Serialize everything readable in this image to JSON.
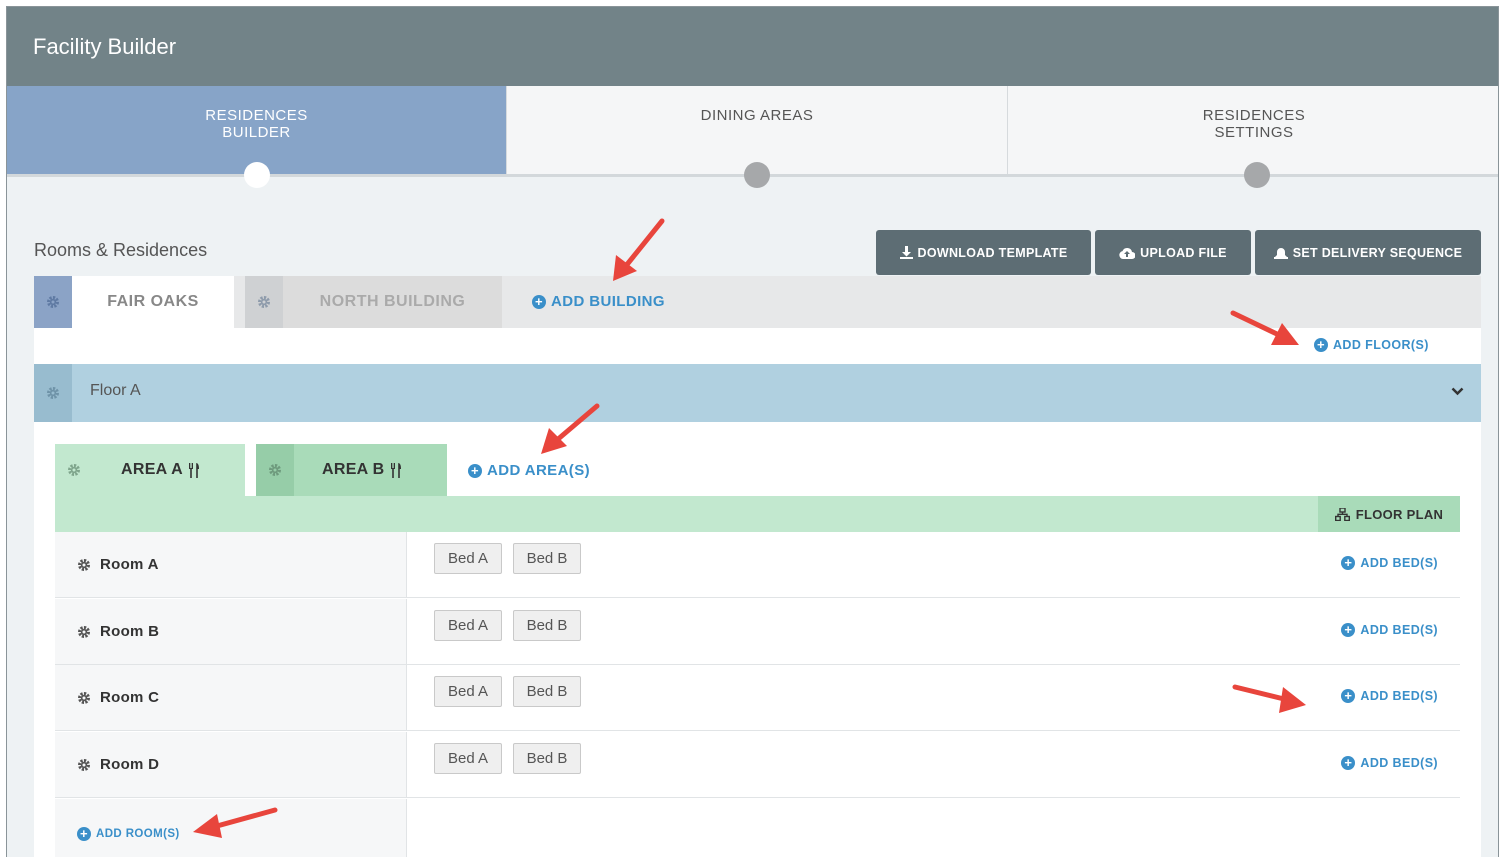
{
  "app": {
    "title": "Facility Builder"
  },
  "steps": [
    {
      "label_line1": "RESIDENCES",
      "label_line2": "BUILDER",
      "active": true
    },
    {
      "label_line1": "DINING AREAS",
      "label_line2": "",
      "active": false
    },
    {
      "label_line1": "RESIDENCES",
      "label_line2": "SETTINGS",
      "active": false
    }
  ],
  "section": {
    "title": "Rooms & Residences"
  },
  "toolbar": {
    "download_label": "DOWNLOAD TEMPLATE",
    "upload_label": "UPLOAD FILE",
    "delivery_label": "SET DELIVERY SEQUENCE"
  },
  "buildings": [
    {
      "name": "FAIR OAKS",
      "active": true
    },
    {
      "name": "NORTH BUILDING",
      "active": false
    }
  ],
  "add_building_label": "ADD BUILDING",
  "add_floor_label": "ADD FLOOR(S)",
  "floor": {
    "name": "Floor A"
  },
  "areas": [
    {
      "name": "AREA A",
      "active": true
    },
    {
      "name": "AREA B",
      "active": false
    }
  ],
  "add_area_label": "ADD AREA(S)",
  "floor_plan_label": "FLOOR PLAN",
  "rooms": [
    {
      "name": "Room A",
      "beds": [
        "Bed A",
        "Bed B"
      ],
      "add_bed_label": "ADD BED(S)"
    },
    {
      "name": "Room B",
      "beds": [
        "Bed A",
        "Bed B"
      ],
      "add_bed_label": "ADD BED(S)"
    },
    {
      "name": "Room C",
      "beds": [
        "Bed A",
        "Bed B"
      ],
      "add_bed_label": "ADD BED(S)"
    },
    {
      "name": "Room D",
      "beds": [
        "Bed A",
        "Bed B"
      ],
      "add_bed_label": "ADD BED(S)"
    }
  ],
  "add_room_label": "ADD ROOM(S)",
  "colors": {
    "header": "#728388",
    "active_step": "#87a4c8",
    "dark_button": "#5d6d74",
    "floor_bar": "#b0d0e0",
    "area_bar": "#c2e8cf",
    "link": "#3a8fc9",
    "annotation_arrow": "#e8453c"
  },
  "icons": [
    "gear-icon",
    "download-icon",
    "cloud-upload-icon",
    "bell-icon",
    "plus-circle-icon",
    "chevron-down-icon",
    "utensils-icon",
    "sitemap-icon",
    "annotation-arrow"
  ]
}
